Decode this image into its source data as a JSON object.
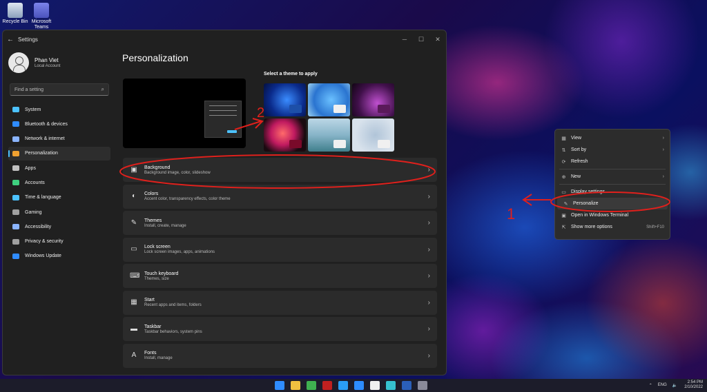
{
  "desktop": {
    "icons": [
      {
        "label": "Recycle Bin",
        "icon": "recycle-bin-icon"
      },
      {
        "label": "Microsoft Teams",
        "icon": "teams-icon"
      }
    ]
  },
  "window": {
    "title": "Settings",
    "controls": [
      "minimize-icon",
      "maximize-icon",
      "close-icon"
    ]
  },
  "profile": {
    "name": "Phan Viet",
    "type": "Local Account"
  },
  "search": {
    "placeholder": "Find a setting"
  },
  "sidebar": {
    "items": [
      {
        "label": "System",
        "icon": "system-icon",
        "color": "#4cc2ff"
      },
      {
        "label": "Bluetooth & devices",
        "icon": "bluetooth-icon",
        "color": "#2f8cff"
      },
      {
        "label": "Network & internet",
        "icon": "network-icon",
        "color": "#8ab4ff"
      },
      {
        "label": "Personalization",
        "icon": "brush-icon",
        "color": "#f0a030",
        "active": true
      },
      {
        "label": "Apps",
        "icon": "apps-icon",
        "color": "#c0c0c0"
      },
      {
        "label": "Accounts",
        "icon": "accounts-icon",
        "color": "#3fd080"
      },
      {
        "label": "Time & language",
        "icon": "globe-clock-icon",
        "color": "#4cc2ff"
      },
      {
        "label": "Gaming",
        "icon": "gaming-icon",
        "color": "#a0a0a0"
      },
      {
        "label": "Accessibility",
        "icon": "accessibility-icon",
        "color": "#8ab4ff"
      },
      {
        "label": "Privacy & security",
        "icon": "shield-icon",
        "color": "#a0a0a0"
      },
      {
        "label": "Windows Update",
        "icon": "windows-update-icon",
        "color": "#2f8cff"
      }
    ]
  },
  "main": {
    "title": "Personalization",
    "theme_heading": "Select a theme to apply",
    "rows": [
      {
        "title": "Background",
        "desc": "Background image, color, slideshow",
        "icon": "image-icon"
      },
      {
        "title": "Colors",
        "desc": "Accent color, transparency effects, color theme",
        "icon": "palette-icon"
      },
      {
        "title": "Themes",
        "desc": "Install, create, manage",
        "icon": "pen-icon"
      },
      {
        "title": "Lock screen",
        "desc": "Lock screen images, apps, animations",
        "icon": "lock-screen-icon"
      },
      {
        "title": "Touch keyboard",
        "desc": "Themes, size",
        "icon": "keyboard-icon"
      },
      {
        "title": "Start",
        "desc": "Recent apps and items, folders",
        "icon": "start-icon"
      },
      {
        "title": "Taskbar",
        "desc": "Taskbar behaviors, system pins",
        "icon": "taskbar-icon"
      },
      {
        "title": "Fonts",
        "desc": "Install, manage",
        "icon": "fonts-icon"
      }
    ]
  },
  "context_menu": {
    "items": [
      {
        "label": "View",
        "icon": "grid-icon",
        "submenu": true
      },
      {
        "label": "Sort by",
        "icon": "sort-icon",
        "submenu": true
      },
      {
        "label": "Refresh",
        "icon": "refresh-icon"
      },
      {
        "label": "New",
        "icon": "new-icon",
        "submenu": true
      },
      {
        "label": "Display settings",
        "icon": "display-icon"
      },
      {
        "label": "Personalize",
        "icon": "pen-icon",
        "highlighted": true
      },
      {
        "label": "Open in Windows Terminal",
        "icon": "terminal-icon"
      },
      {
        "label": "Show more options",
        "icon": "more-options-icon",
        "shortcut": "Shift+F10"
      }
    ]
  },
  "annotations": {
    "labels": [
      "2",
      "1"
    ],
    "color": "#e0201c"
  },
  "taskbar": {
    "apps": [
      "windows-start-icon",
      "search-icon",
      "file-explorer-icon",
      "chrome-icon",
      "app-icon",
      "skype-icon",
      "zoom-icon",
      "medium-icon",
      "edge-icon",
      "word-icon",
      "settings-icon"
    ],
    "tray": {
      "language": "ENG",
      "time": "2:54 PM",
      "date": "2/10/2022"
    }
  }
}
